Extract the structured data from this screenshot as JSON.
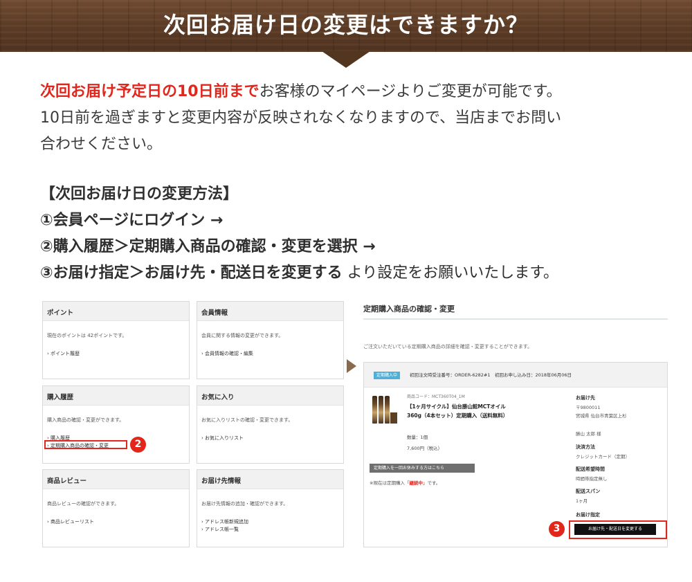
{
  "banner": {
    "title": "次回お届け日の変更はできますか？"
  },
  "intro": {
    "highlight": "次回お届け予定日の10日前まで",
    "line1_rest": "お客様のマイページよりご変更が可能です。",
    "line2": "10日前を過ぎますと変更内容が反映されなくなりますので、当店までお問い",
    "line3": "合わせください。"
  },
  "steps": {
    "heading": "【次回お届け日の変更方法】",
    "step1": "①会員ページにログイン →",
    "step2": "②購入履歴＞定期購入商品の確認・変更を選択 →",
    "step3_bold": "③お届け指定＞お届け先・配送日を変更する",
    "step3_rest": " より設定をお願いいたします。"
  },
  "panels": {
    "points": {
      "title": "ポイント",
      "desc": "現在のポイントは 42ポイントです。",
      "link1": "› ポイント履歴"
    },
    "member": {
      "title": "会員情報",
      "desc": "会員に関する情報の変更ができます。",
      "link1": "› 会員情報の確認・編集"
    },
    "history": {
      "title": "購入履歴",
      "desc": "購入商品の確認・変更ができます。",
      "link1": "› 購入履歴",
      "link2": "› 定期購入商品の確認・変更"
    },
    "favorites": {
      "title": "お気に入り",
      "desc": "お気に入りリストの確認・変更できます。",
      "link1": "› お気に入りリスト"
    },
    "review": {
      "title": "商品レビュー",
      "desc": "商品レビューの確認ができます。",
      "link1": "› 商品レビューリスト"
    },
    "address": {
      "title": "お届け先情報",
      "desc": "お届け先情報の追加・確認ができます。",
      "link1": "› アドレス帳新規追加",
      "link2": "› アドレス帳一覧"
    }
  },
  "markers": {
    "two": "2",
    "three": "3"
  },
  "right": {
    "title": "定期購入商品の確認・変更",
    "desc": "ご注文いただいている定期購入商品の詳細を確認・変更することができます。",
    "badge": "定期購入中",
    "order_info": "初回注文時受注番号：ORDER-6282#1　初回お申し込み日：2018年06月06日",
    "product_code": "商品コード：MCT360T04_1M",
    "product_name": "【1ヶ月サイクル】仙台勝山館MCTオイル 360g（4本セット）定期購入（送料無料）",
    "quantity": "数量：1個",
    "price": "7,600円（税込）",
    "pause_button": "定期購入を一回お休みする方はこちら",
    "note_prefix": "※現在は定期購入「",
    "note_status": "継続中",
    "note_suffix": "」です。",
    "dest_label": "お届け先",
    "postal": "〒9800011",
    "address": "宮城県 仙台市青葉区上杉",
    "name": "勝山 太郎 様",
    "payment_label": "決済方法",
    "payment_value": "クレジットカード（定期）",
    "time_label": "配送希望時間",
    "time_value": "時間帯指定無し",
    "span_label": "配送スパン",
    "span_value": "1ヶ月",
    "delivery_label": "お届け指定",
    "change_button": "お届け先・配送日を変更する"
  }
}
